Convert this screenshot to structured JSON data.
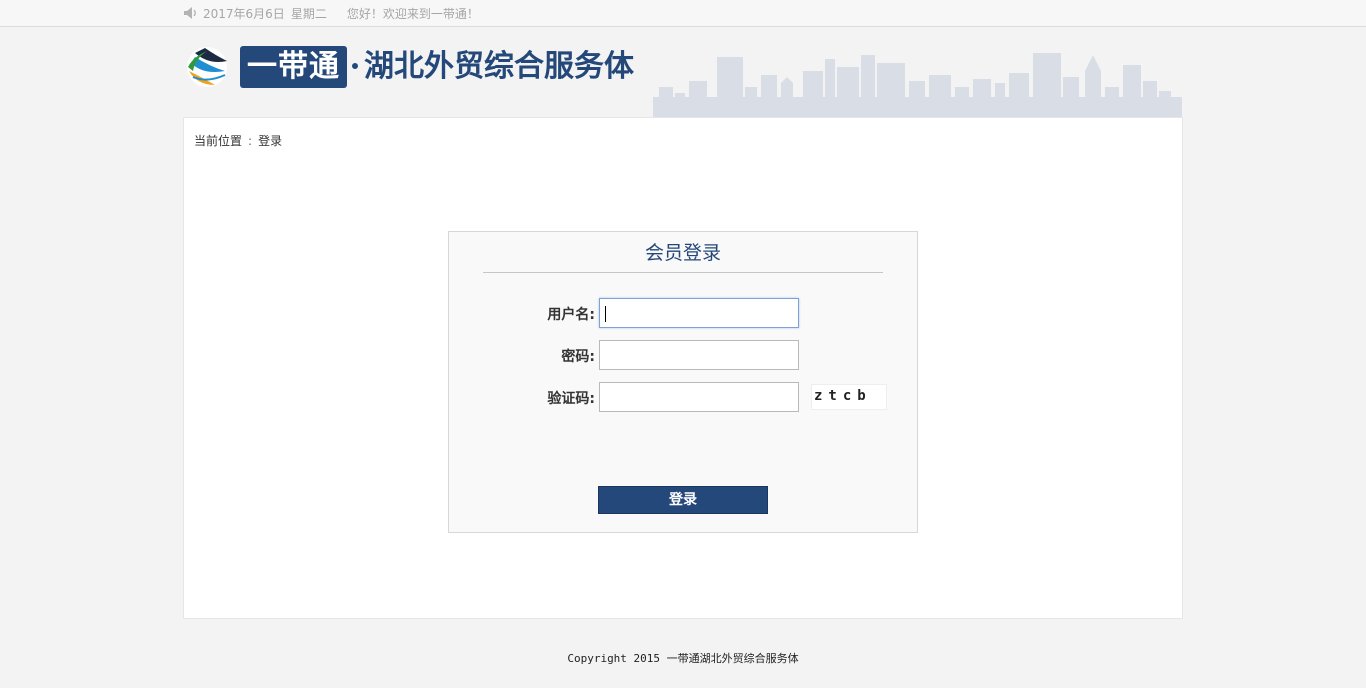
{
  "topbar": {
    "date": "2017年6月6日",
    "weekday": "星期二",
    "welcome": "您好！欢迎来到一带通！"
  },
  "header": {
    "logo_box_text": "一带通",
    "logo_text": "湖北外贸综合服务体"
  },
  "breadcrumb": {
    "prefix": "当前位置",
    "separator": ":",
    "current": "登录"
  },
  "login": {
    "title": "会员登录",
    "username_label": "用户名:",
    "username_value": "",
    "password_label": "密码:",
    "password_value": "",
    "captcha_label": "验证码:",
    "captcha_value": "",
    "captcha_image_text": "ztcb",
    "submit_label": "登录"
  },
  "footer": {
    "copyright": "Copyright 2015 一带通湖北外贸综合服务体"
  },
  "colors": {
    "brand": "#25487a",
    "background": "#f3f3f3",
    "skyline": "#d9dee6"
  }
}
